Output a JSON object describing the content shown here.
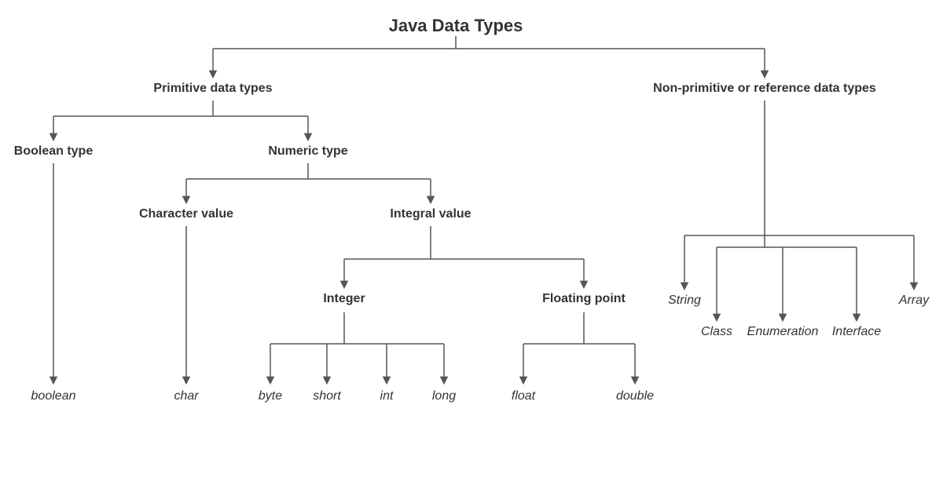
{
  "title": "Java Data Types",
  "primitive": {
    "label": "Primitive data types",
    "boolean_type": "Boolean type",
    "numeric_type": "Numeric type",
    "character_value": "Character value",
    "integral_value": "Integral value",
    "integer": "Integer",
    "floating_point": "Floating point",
    "leaves": {
      "boolean": "boolean",
      "char": "char",
      "byte": "byte",
      "short": "short",
      "int": "int",
      "long": "long",
      "float": "float",
      "double": "double"
    }
  },
  "reference": {
    "label": "Non-primitive or reference data types",
    "leaves": {
      "string": "String",
      "class": "Class",
      "enumeration": "Enumeration",
      "interface": "Interface",
      "array": "Array"
    }
  }
}
